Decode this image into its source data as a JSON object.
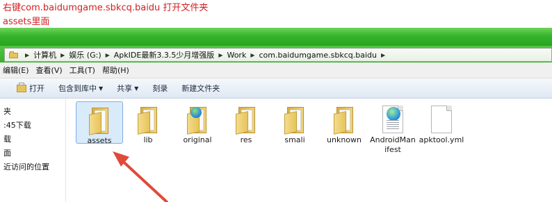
{
  "notes": {
    "line1": "右键com.baidumgame.sbkcq.baidu 打开文件夹",
    "line2": "assets里面"
  },
  "address": {
    "crumbs": [
      "计算机",
      "娱乐 (G:)",
      "ApkIDE最新3.3.5少月增强版",
      "Work",
      "com.baidumgame.sbkcq.baidu"
    ]
  },
  "menu": {
    "edit": "编辑(E)",
    "view": "查看(V)",
    "tools": "工具(T)",
    "help": "帮助(H)"
  },
  "toolbar": {
    "open": "打开",
    "include_library": "包含到库中",
    "share": "共享",
    "burn": "刻录",
    "new_folder": "新建文件夹"
  },
  "nav": {
    "items": [
      "夹",
      ":45下载",
      "载",
      "面",
      "近访问的位置"
    ]
  },
  "files": [
    {
      "name": "assets",
      "kind": "folder",
      "selected": true
    },
    {
      "name": "lib",
      "kind": "folder"
    },
    {
      "name": "original",
      "kind": "folder-globe"
    },
    {
      "name": "res",
      "kind": "folder"
    },
    {
      "name": "smali",
      "kind": "folder"
    },
    {
      "name": "unknown",
      "kind": "folder"
    },
    {
      "name": "AndroidManifest",
      "kind": "xml"
    },
    {
      "name": "apktool.yml",
      "kind": "file"
    }
  ],
  "colors": {
    "annotation": "#d21f1f",
    "titlebar_green": "#35b42b",
    "selection": "#d9ebfb"
  }
}
